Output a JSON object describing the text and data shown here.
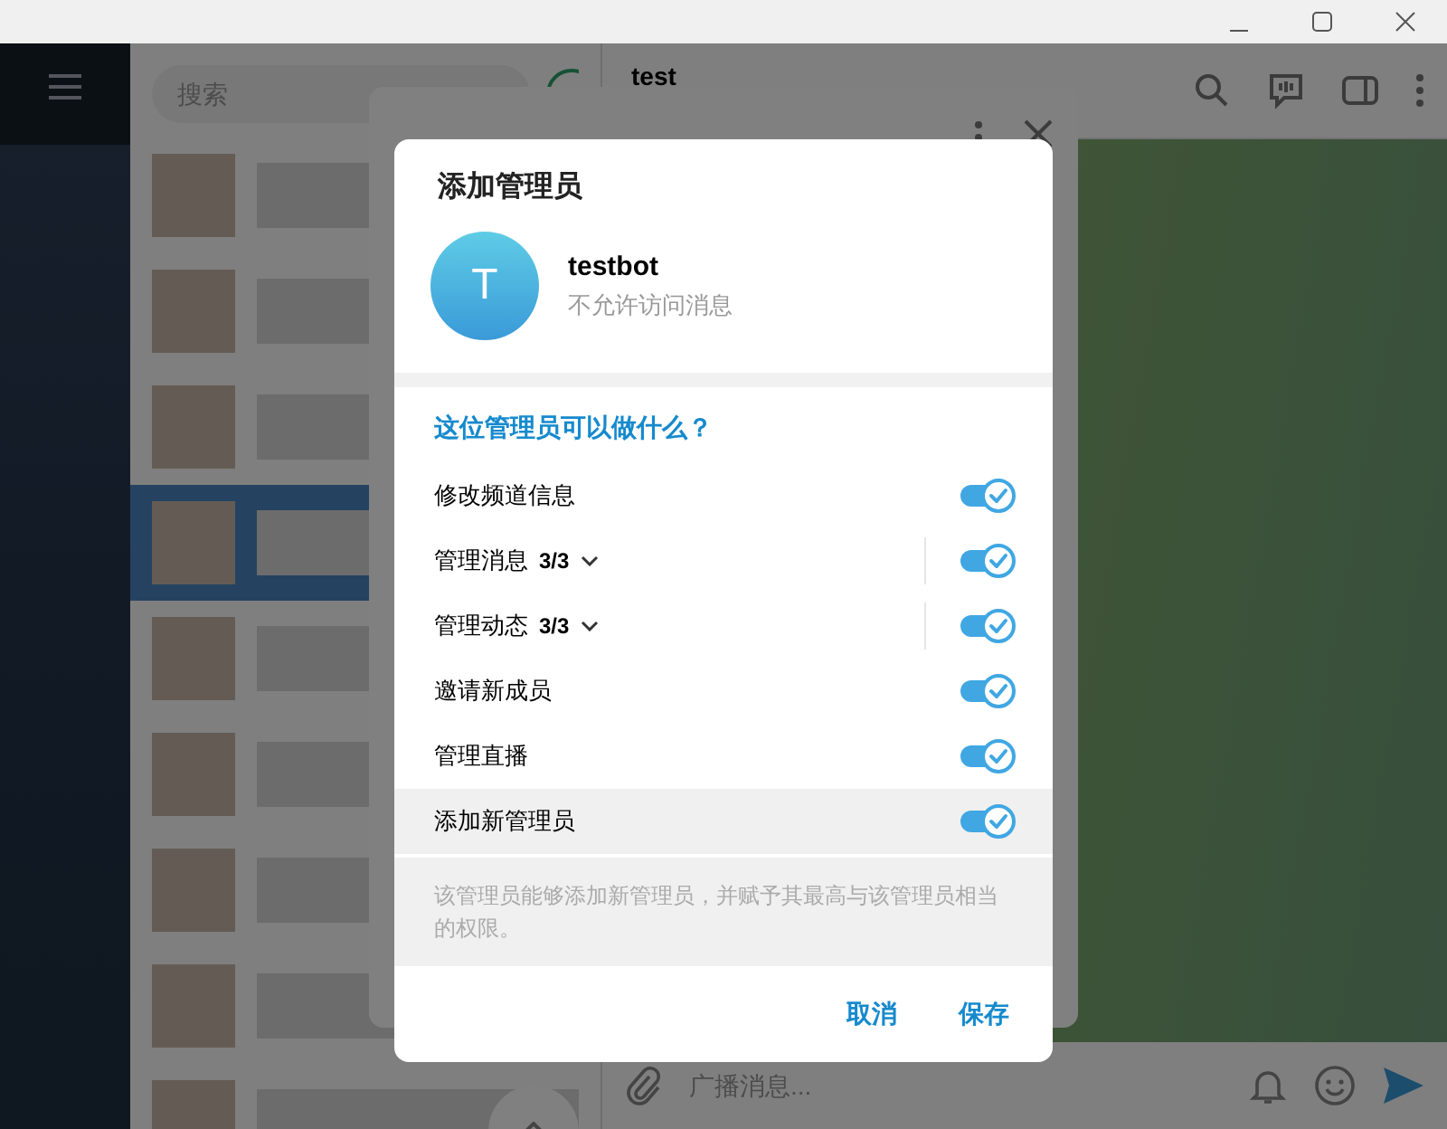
{
  "search": {
    "placeholder": "搜索"
  },
  "chat_header": {
    "title": "test"
  },
  "composer": {
    "placeholder": "广播消息..."
  },
  "dialog": {
    "title": "添加管理员",
    "user": {
      "avatar_letter": "T",
      "name": "testbot",
      "status": "不允许访问消息"
    },
    "section_title": "这位管理员可以做什么？",
    "permissions": [
      {
        "kind": "simple",
        "label": "修改频道信息",
        "on": true,
        "hovered": false
      },
      {
        "kind": "group",
        "label": "管理消息",
        "count": "3/3",
        "on": true,
        "hovered": false
      },
      {
        "kind": "group",
        "label": "管理动态",
        "count": "3/3",
        "on": true,
        "hovered": false
      },
      {
        "kind": "simple",
        "label": "邀请新成员",
        "on": true,
        "hovered": false
      },
      {
        "kind": "simple",
        "label": "管理直播",
        "on": true,
        "hovered": false
      },
      {
        "kind": "simple",
        "label": "添加新管理员",
        "on": true,
        "hovered": true
      }
    ],
    "note": "该管理员能够添加新管理员，并赋予其最高与该管理员相当的权限。",
    "buttons": [
      "取消",
      "保存"
    ]
  }
}
